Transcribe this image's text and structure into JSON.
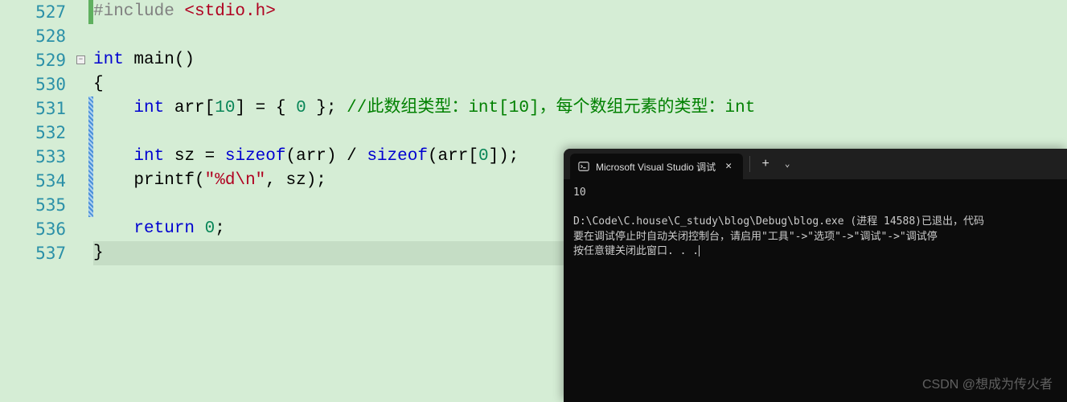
{
  "gutter": {
    "lines": [
      "527",
      "528",
      "529",
      "530",
      "531",
      "532",
      "533",
      "534",
      "535",
      "536",
      "537"
    ]
  },
  "code": {
    "l527": {
      "pp": "#include ",
      "inc": "<stdio.h>"
    },
    "l529": {
      "kw1": "int",
      "fn": " main",
      "rest": "()"
    },
    "l530": {
      "t": "{"
    },
    "l531": {
      "indent": "    ",
      "kw1": "int",
      "sp1": " arr[",
      "n1": "10",
      "mid": "] = { ",
      "n2": "0",
      "end": " }; ",
      "cm": "//此数组类型：int[10]，每个数组元素的类型：int"
    },
    "l533": {
      "indent": "    ",
      "kw1": "int",
      "sp1": " sz = ",
      "kw2": "sizeof",
      "p1": "(arr) / ",
      "kw3": "sizeof",
      "p2": "(arr[",
      "n1": "0",
      "p3": "]);"
    },
    "l534": {
      "indent": "    ",
      "fn": "printf",
      "p1": "(",
      "str": "\"%d\\n\"",
      "p2": ", sz);"
    },
    "l536": {
      "indent": "    ",
      "kw1": "return",
      "sp": " ",
      "n1": "0",
      "end": ";"
    },
    "l537": {
      "t": "}"
    }
  },
  "console": {
    "tab_title": "Microsoft Visual Studio 调试",
    "output": "10",
    "line1": "D:\\Code\\C.house\\C_study\\blog\\Debug\\blog.exe (进程 14588)已退出，代码",
    "line2": "要在调试停止时自动关闭控制台，请启用\"工具\"->\"选项\"->\"调试\"->\"调试停",
    "line3": "按任意键关闭此窗口. . ."
  },
  "watermark": "CSDN @想成为传火者"
}
